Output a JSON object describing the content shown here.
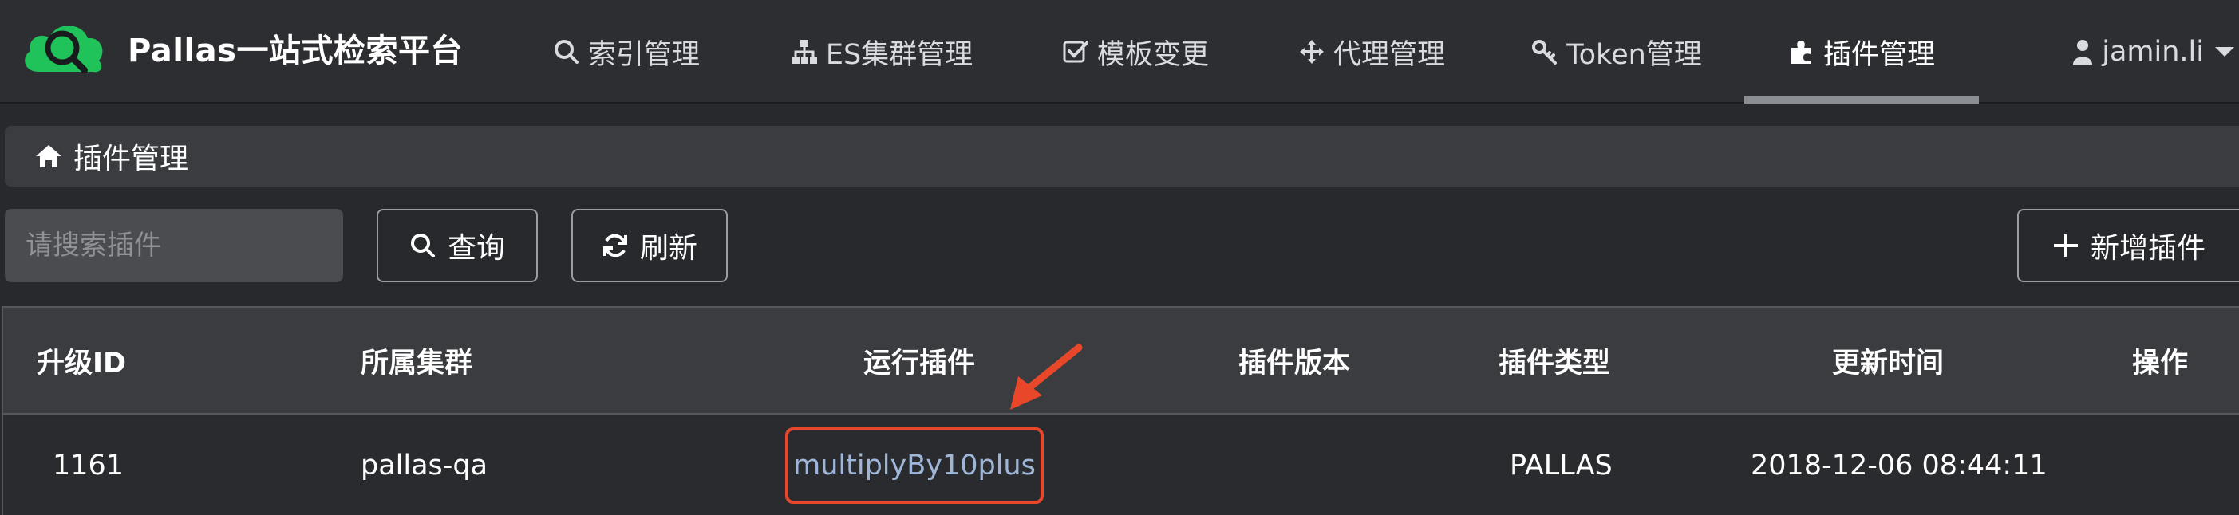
{
  "app": {
    "title": "Pallas一站式检索平台",
    "logo_icon": "cloud-search-icon",
    "accent_color": "#1fc35a"
  },
  "nav": {
    "items": [
      {
        "label": "索引管理",
        "icon": "search-icon"
      },
      {
        "label": "ES集群管理",
        "icon": "sitemap-icon"
      },
      {
        "label": "模板变更",
        "icon": "check-square-icon"
      },
      {
        "label": "代理管理",
        "icon": "move-arrows-icon"
      },
      {
        "label": "Token管理",
        "icon": "key-icon"
      },
      {
        "label": "插件管理",
        "icon": "puzzle-icon",
        "active": true
      }
    ],
    "user": "jamin.li"
  },
  "breadcrumb": {
    "label": "插件管理",
    "icon": "home-icon"
  },
  "toolbar": {
    "search_placeholder": "请搜索插件",
    "search_value": "",
    "query_label": "查询",
    "refresh_label": "刷新",
    "add_label": "新增插件"
  },
  "table": {
    "columns": [
      "升级ID",
      "所属集群",
      "运行插件",
      "插件版本",
      "插件类型",
      "更新时间",
      "操作"
    ],
    "rows": [
      {
        "id": "1161",
        "cluster": "pallas-qa",
        "plugin": "multiplyBy10plus",
        "version": "",
        "type": "PALLAS",
        "updated": "2018-12-06 08:44:11",
        "action": ""
      }
    ]
  },
  "annotation": {
    "highlight_color": "#e8472a"
  }
}
